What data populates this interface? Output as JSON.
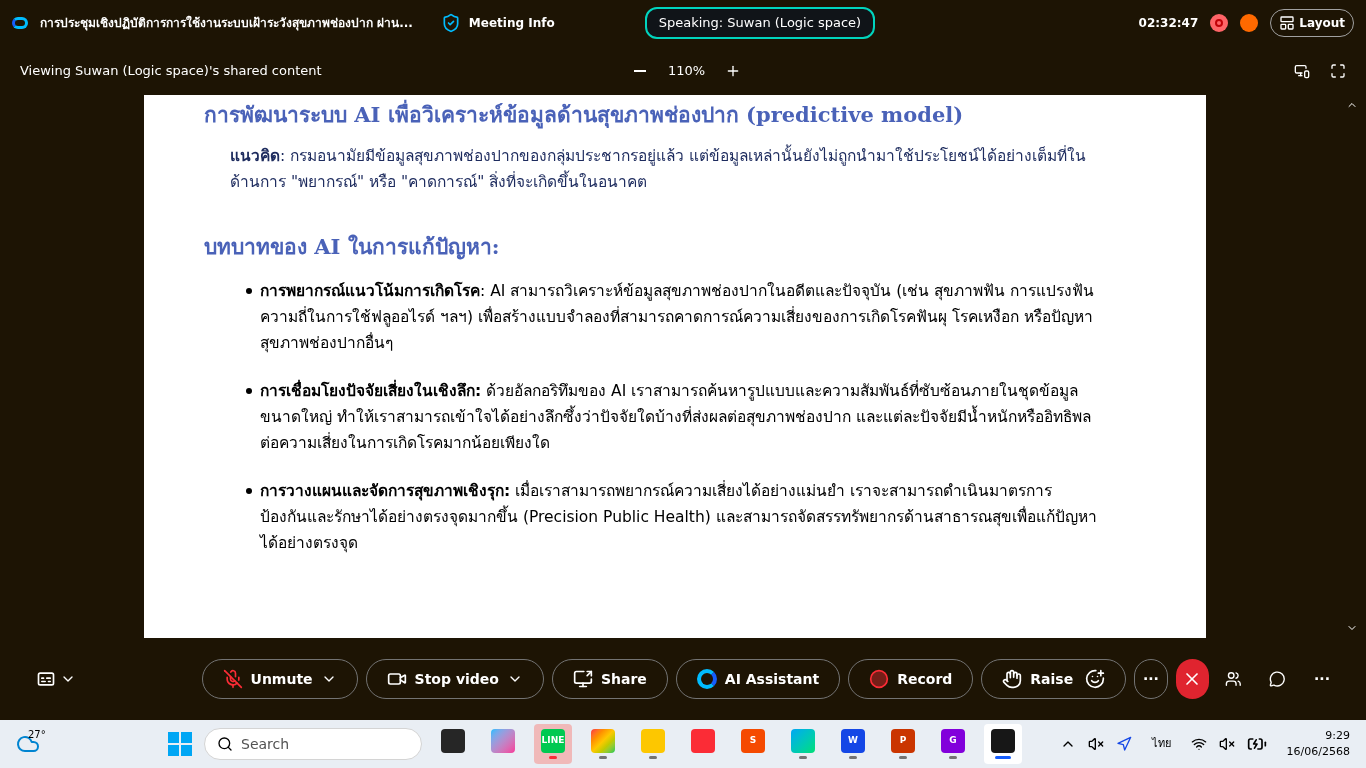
{
  "title_bar": {
    "meeting_title": "การประชุมเชิงปฏิบัติการการใช้งานระบบเฝ้าระวังสุขภาพช่องปาก ผ่าน...",
    "meeting_info": "Meeting Info",
    "speaking": "Speaking: Suwan (Logic space)",
    "timer": "02:32:47",
    "layout_button": "Layout"
  },
  "share_bar": {
    "viewing": "Viewing Suwan (Logic space)'s shared content",
    "zoom": "110%"
  },
  "slide": {
    "heading": "การพัฒนาระบบ AI เพื่อวิเคราะห์ข้อมูลด้านสุขภาพช่องปาก (predictive model)",
    "concept": "**แนวคิด**: กรมอนามัยมีข้อมูลสุขภาพช่องปากของกลุ่มประชากรอยู่แล้ว แต่ข้อมูลเหล่านั้นยังไม่ถูกนำมาใช้ประโยชน์ได้อย่างเต็มที่ในด้านการ \"พยากรณ์\" หรือ \"คาดการณ์\" สิ่งที่จะเกิดขึ้นในอนาคต",
    "subheading": "บทบาทของ AI ในการแก้ปัญหา:",
    "bullets": [
      "**การพยากรณ์แนวโน้มการเกิดโรค**: AI สามารถวิเคราะห์ข้อมูลสุขภาพช่องปากในอดีตและปัจจุบัน (เช่น สุขภาพฟัน การแปรงฟัน ความถี่ในการใช้ฟลูออไรด์ ฯลฯ) เพื่อสร้างแบบจำลองที่สามารถคาดการณ์ความเสี่ยงของการเกิดโรคฟันผุ โรคเหงือก หรือปัญหาสุขภาพช่องปากอื่นๆ",
      "**การเชื่อมโยงปัจจัยเสี่ยงในเชิงลึก:** ด้วยอัลกอริทึมของ AI เราสามารถค้นหารูปแบบและความสัมพันธ์ที่ซับซ้อนภายในชุดข้อมูลขนาดใหญ่ ทำให้เราสามารถเข้าใจได้อย่างลึกซึ้งว่าปัจจัยใดบ้างที่ส่งผลต่อสุขภาพช่องปาก และแต่ละปัจจัยมีน้ำหนักหรืออิทธิพลต่อความเสี่ยงในการเกิดโรคมากน้อยเพียงใด",
      "**การวางแผนและจัดการสุขภาพเชิงรุก:** เมื่อเราสามารถพยากรณ์ความเสี่ยงได้อย่างแม่นยำ เราจะสามารถดำเนินมาตรการป้องกันและรักษาได้อย่างตรงจุดมากขึ้น (Precision Public Health) และสามารถจัดสรรทรัพยากรด้านสาธารณสุขเพื่อแก้ปัญหาได้อย่างตรงจุด"
    ]
  },
  "controls": {
    "muted": true,
    "buttons": [
      {
        "kind": "mute",
        "label": "Unmute"
      },
      {
        "kind": "video",
        "label": "Stop video"
      },
      {
        "kind": "share",
        "label": "Share"
      },
      {
        "kind": "ai",
        "label": "AI Assistant"
      },
      {
        "kind": "record",
        "label": "Record"
      },
      {
        "kind": "raise",
        "label": "Raise"
      }
    ],
    "more": "···",
    "right_more": "···"
  },
  "taskbar": {
    "temperature": "27°",
    "search_placeholder": "Search",
    "apps": [
      {
        "kind": "files",
        "running": false,
        "attention": false
      },
      {
        "kind": "copilot",
        "running": false,
        "attention": false
      },
      {
        "kind": "line",
        "label": "LINE",
        "running": true,
        "attention": true
      },
      {
        "kind": "chrome",
        "running": true,
        "attention": false
      },
      {
        "kind": "folder",
        "running": true,
        "attention": false
      },
      {
        "kind": "anydesk",
        "running": false,
        "attention": false
      },
      {
        "kind": "s",
        "label": "S",
        "running": false,
        "attention": false
      },
      {
        "kind": "edge",
        "running": true,
        "attention": false
      },
      {
        "kind": "word",
        "label": "W",
        "running": true,
        "attention": false
      },
      {
        "kind": "ppt",
        "label": "P",
        "running": true,
        "attention": false
      },
      {
        "kind": "pdf",
        "label": "G",
        "running": true,
        "attention": false
      },
      {
        "kind": "webex",
        "running": true,
        "attention": false,
        "selected": true
      }
    ],
    "language": "ไทย",
    "time": "9:29",
    "date": "16/06/2568"
  }
}
